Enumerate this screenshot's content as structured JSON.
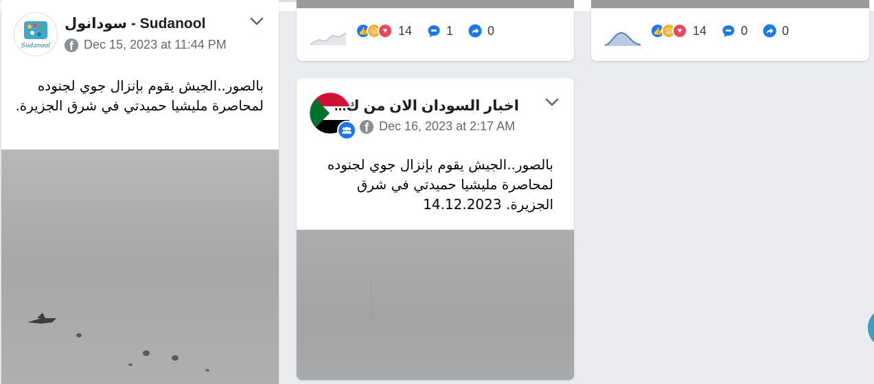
{
  "colors": {
    "accent": "#1877f2",
    "page_bg": "#e9ebee",
    "muted_text": "#65676b"
  },
  "posts": [
    {
      "page_name": "سودانول - Sudanool",
      "avatar_text": "Sudanool",
      "platform_icon": "facebook-icon",
      "timestamp": "Dec 15, 2023 at 11:44 PM",
      "text": "بالصور..الجيش يقوم بإنزال جوي لجنوده لمحاصرة مليشيا حميدتي في شرق الجزيرة."
    },
    {
      "page_name": "اخبار السودان الان من ك...",
      "platform_icon": "facebook-icon",
      "timestamp": "Dec 16, 2023 at 2:17 AM",
      "text": "بالصور..الجيش يقوم بإنزال جوي لجنوده لمحاصرة مليشيا حميدتي في شرق الجزيرة. 14.12.2023"
    }
  ],
  "stat_cards": [
    {
      "reactions": "14",
      "comments": "1",
      "shares": "0"
    },
    {
      "reactions": "14",
      "comments": "0",
      "shares": "0"
    }
  ]
}
